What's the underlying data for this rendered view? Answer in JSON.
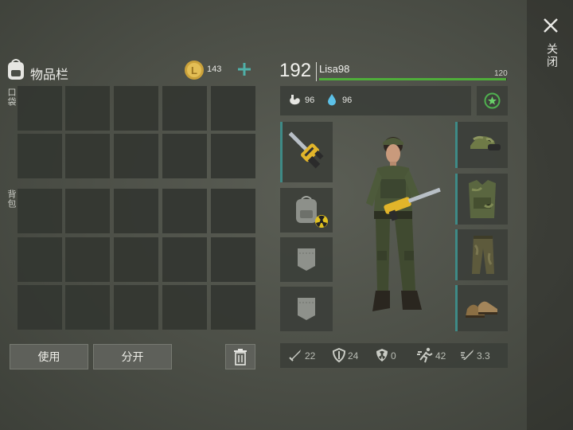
{
  "inventory": {
    "title": "物品栏",
    "coin_count": "143",
    "pocket_label": "口袋",
    "backpack_label": "背包"
  },
  "buttons": {
    "use": "使用",
    "split": "分开"
  },
  "player": {
    "level": "192",
    "name": "Lisa98",
    "xp_value": "120",
    "xp_fraction": 0.995,
    "food": "96",
    "water": "96"
  },
  "stats": {
    "attack": "22",
    "defense": "24",
    "radiation": "0",
    "speed": "42",
    "attack_speed": "3.3"
  },
  "close_label": "关闭",
  "colors": {
    "accent": "#3e8a86",
    "xp_bar": "#4fae3a",
    "teal": "#4fb0a8"
  }
}
